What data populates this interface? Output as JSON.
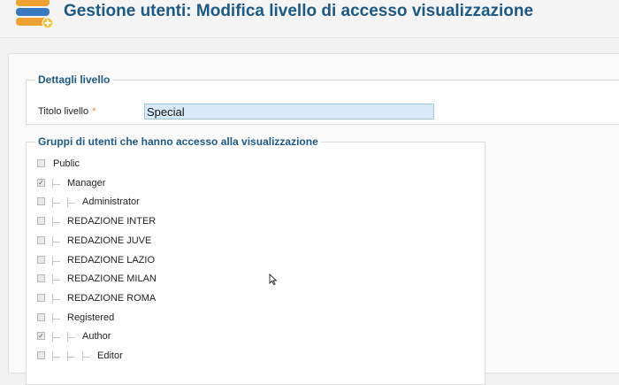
{
  "header": {
    "title": "Gestione utenti: Modifica livello di accesso visualizzazione",
    "logo_icon": "users-stack-icon"
  },
  "details": {
    "legend": "Dettagli livello",
    "title_label": "Titolo livello",
    "required_mark": "*",
    "title_value": "Special"
  },
  "groups": {
    "legend": "Gruppi di utenti che hanno accesso alla visualizzazione",
    "items": [
      {
        "label": "Public",
        "depth": 0,
        "checked": false
      },
      {
        "label": "Manager",
        "depth": 1,
        "checked": true
      },
      {
        "label": "Administrator",
        "depth": 2,
        "checked": false
      },
      {
        "label": "REDAZIONE INTER",
        "depth": 1,
        "checked": false
      },
      {
        "label": "REDAZIONE JUVE",
        "depth": 1,
        "checked": false
      },
      {
        "label": "REDAZIONE LAZIO",
        "depth": 1,
        "checked": false
      },
      {
        "label": "REDAZIONE MILAN",
        "depth": 1,
        "checked": false
      },
      {
        "label": "REDAZIONE ROMA",
        "depth": 1,
        "checked": false
      },
      {
        "label": "Registered",
        "depth": 1,
        "checked": false
      },
      {
        "label": "Author",
        "depth": 2,
        "checked": true
      },
      {
        "label": "Editor",
        "depth": 3,
        "checked": false
      }
    ]
  }
}
